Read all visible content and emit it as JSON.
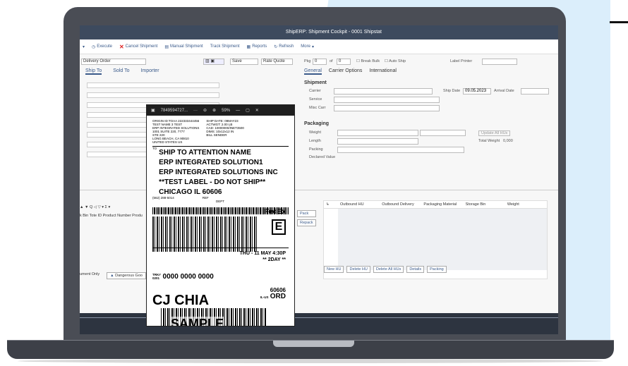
{
  "app": {
    "title": "ShipERP: Shipment Cockpit - 0001 Shipstat"
  },
  "toolbar": {
    "execute": "Execute",
    "cancel_shipment": "Cancel Shipment",
    "manual_shipment": "Manual Shipment",
    "track_shipment": "Track Shipment",
    "reports": "Reports",
    "refresh": "Refresh",
    "more": "More"
  },
  "form": {
    "order_type": "Delivery Order",
    "save": "Save",
    "rate_quote": "Rate Quote",
    "pkg_label": "Pkg",
    "pkg_value": "0",
    "of_label": "of",
    "of_value": "0",
    "break_bulk": "Break Bulk",
    "auto_ship": "Auto Ship",
    "label_printer": "Label Printer"
  },
  "tabs_left": [
    "Ship To",
    "Sold To",
    "Importer"
  ],
  "tabs_right": [
    "General",
    "Carrier Options",
    "International"
  ],
  "shipment": {
    "heading": "Shipment",
    "carrier": "Carrier",
    "service": "Service",
    "misc_carr": "Misc Carr",
    "ship_date_label": "Ship Date",
    "ship_date": "09.05.2023",
    "arrival_date": "Arrival Date"
  },
  "packaging": {
    "heading": "Packaging",
    "weight": "Weight",
    "length": "Length",
    "packing": "Packing",
    "declared_value": "Declared Value",
    "update_all": "Update All HUs",
    "total_weight_label": "Total Weight",
    "total_weight": "0,000"
  },
  "grid": {
    "columns": [
      "Outbound HU",
      "Outbound Delivery",
      "Packaging Material",
      "Storage Bin",
      "Weight"
    ],
    "buttons": [
      "New HU",
      "Delete HU",
      "Delete All HUs",
      "Details",
      "Packing"
    ]
  },
  "side_buttons": [
    "Pack",
    "Repack"
  ],
  "lower_left": {
    "columns": "k Bin Tote ID Product Number Produ"
  },
  "status": {
    "item1": "ument Only",
    "dangerous": "Dangerous Goo"
  },
  "label": {
    "window_title": "7849594727...",
    "zoom": "59%",
    "origin_block": [
      "ORIGIN ID:TOAA   222333444456",
      "TEST NAME 3 TEST",
      "ERP INTEGRATED SOLUTIONS",
      "1001 SUITE 220, 7777",
      "STE 220",
      "LONG BEACH, CA 90810",
      "UNITED STATES US"
    ],
    "ship_block": [
      "SHIP DATE: 09MAY23",
      "ACTWGT: 2.00 LB",
      "CAD: 10000000/INET3500",
      "DIMS: 10x12x12 IN",
      "",
      "BILL SENDER"
    ],
    "to_label": "TO",
    "ship_to": [
      "SHIP TO ATTENTION NAME",
      "ERP INTEGRATED SOLUTION1",
      "ERP INTEGRATED SOLUTIONS INC",
      "**TEST LABEL - DO NOT SHIP**",
      "CHICAGO IL 60606"
    ],
    "phone": "(562) 288-5014",
    "ref": "REF",
    "dept": "DEPT",
    "carrier_logo": "FedEx",
    "service_letter": "E",
    "date_line": "THU - 11 MAY 4:30P",
    "service_line": "** 2DAY **",
    "trk_label": "TRK#",
    "trk_code": "0201",
    "tracking": "0000 0000 0000",
    "zip": "60606",
    "airport": "ORD",
    "state": "IL-US",
    "route": "CJ CHIA",
    "watermark": "SAMPLE"
  }
}
